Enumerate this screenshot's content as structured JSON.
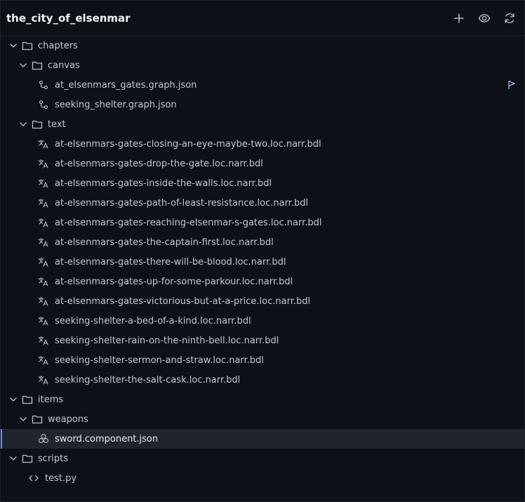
{
  "header": {
    "title": "the_city_of_elsenmar",
    "actions": [
      {
        "name": "add-icon"
      },
      {
        "name": "eye-icon"
      },
      {
        "name": "refresh-icon"
      }
    ]
  },
  "tree": {
    "chapters": "chapters",
    "canvas": "canvas",
    "canvas_files": [
      "at_elsenmars_gates.graph.json",
      "seeking_shelter.graph.json"
    ],
    "text": "text",
    "text_files": [
      "at-elsenmars-gates-closing-an-eye-maybe-two.loc.narr.bdl",
      "at-elsenmars-gates-drop-the-gate.loc.narr.bdl",
      "at-elsenmars-gates-inside-the-walls.loc.narr.bdl",
      "at-elsenmars-gates-path-of-least-resistance.loc.narr.bdl",
      "at-elsenmars-gates-reaching-elsenmar-s-gates.loc.narr.bdl",
      "at-elsenmars-gates-the-captain-first.loc.narr.bdl",
      "at-elsenmars-gates-there-will-be-blood.loc.narr.bdl",
      "at-elsenmars-gates-up-for-some-parkour.loc.narr.bdl",
      "at-elsenmars-gates-victorious-but-at-a-price.loc.narr.bdl",
      "seeking-shelter-a-bed-of-a-kind.loc.narr.bdl",
      "seeking-shelter-rain-on-the-ninth-bell.loc.narr.bdl",
      "seeking-shelter-sermon-and-straw.loc.narr.bdl",
      "seeking-shelter-the-salt-cask.loc.narr.bdl"
    ],
    "items": "items",
    "weapons": "weapons",
    "weapon_file": "sword.component.json",
    "scripts": "scripts",
    "script_file": "test.py"
  },
  "colors": {
    "background": "#0d1017",
    "selected_row": "#1f242d",
    "selected_accent": "#7b8cd6",
    "flag": "#a9b8f0"
  }
}
